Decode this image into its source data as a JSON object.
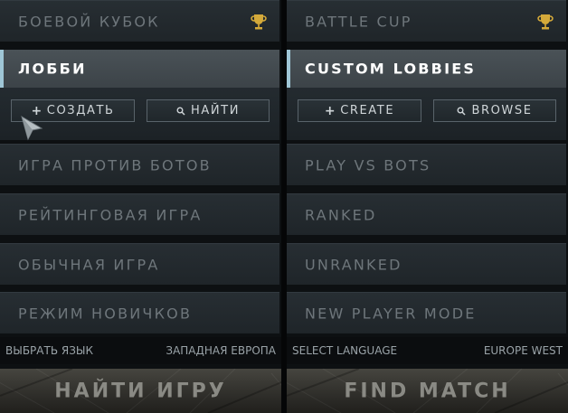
{
  "panels": {
    "left": {
      "battle_cup": "БОЕВОЙ КУБОК",
      "lobbies": "ЛОББИ",
      "create_label": "СОЗДАТЬ",
      "browse_label": "НАЙТИ",
      "modes": [
        "ИГРА ПРОТИВ БОТОВ",
        "РЕЙТИНГОВАЯ ИГРА",
        "ОБЫЧНАЯ ИГРА",
        "РЕЖИМ НОВИЧКОВ"
      ],
      "select_language": "ВЫБРАТЬ ЯЗЫК",
      "region": "ЗАПАДНАЯ ЕВРОПА",
      "find_match": "НАЙТИ ИГРУ"
    },
    "right": {
      "battle_cup": "BATTLE CUP",
      "lobbies": "CUSTOM LOBBIES",
      "create_label": "CREATE",
      "browse_label": "BROWSE",
      "modes": [
        "PLAY VS BOTS",
        "RANKED",
        "UNRANKED",
        "NEW PLAYER MODE"
      ],
      "select_language": "SELECT LANGUAGE",
      "region": "EUROPE WEST",
      "find_match": "FIND MATCH"
    }
  },
  "icons": {
    "trophy": "trophy-icon",
    "plus": "plus-icon",
    "search": "search-icon",
    "cursor": "cursor-icon"
  },
  "colors": {
    "accent": "#9fc6d6",
    "trophy_gold": "#d4a93a",
    "active_text": "#ffffff",
    "inactive_text": "#6e767b"
  }
}
